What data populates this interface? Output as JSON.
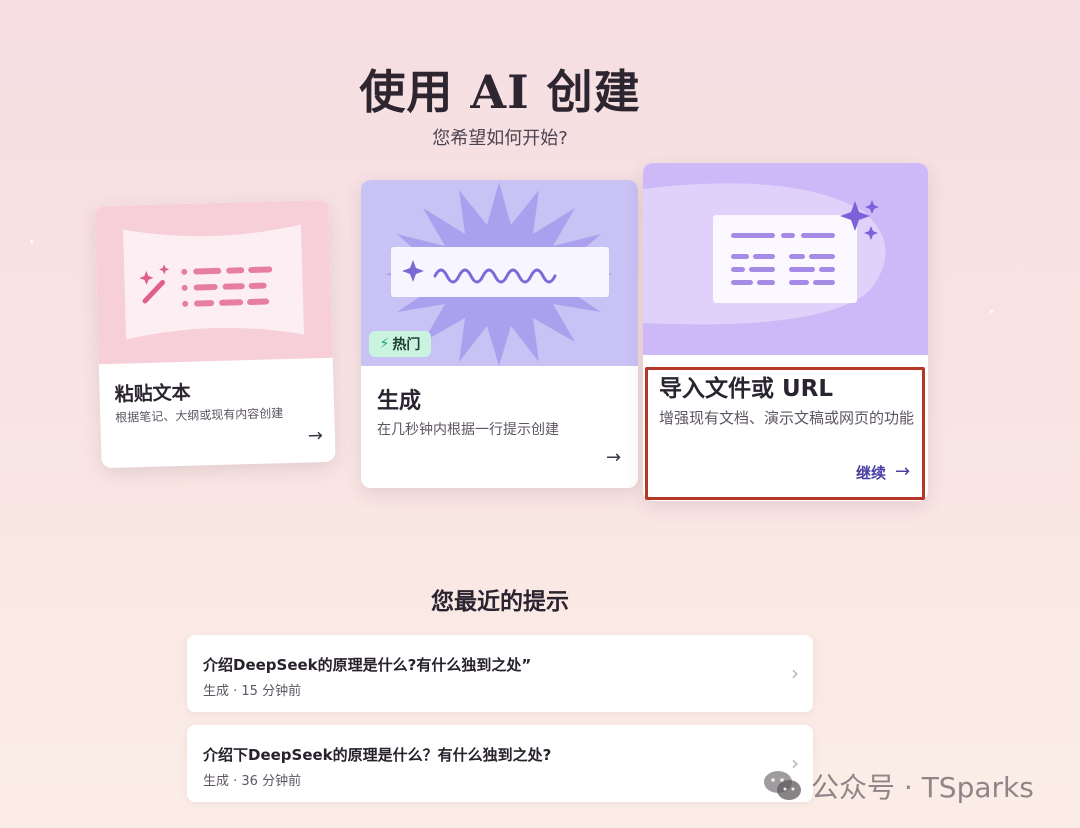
{
  "header": {
    "title": "使用 AI 创建",
    "subtitle": "您希望如何开始?"
  },
  "cards": {
    "paste": {
      "title": "粘贴文本",
      "description": "根据笔记、大纲或现有内容创建",
      "action_icon": "arrow-right-icon"
    },
    "generate": {
      "badge": "热门",
      "title": "生成",
      "description": "在几秒钟内根据一行提示创建",
      "action_icon": "arrow-right-icon"
    },
    "import": {
      "title": "导入文件或 URL",
      "description": "增强现有文档、演示文稿或网页的功能",
      "continue_label": "继续",
      "highlighted": true,
      "highlight_color": "#b53728"
    }
  },
  "recent": {
    "title": "您最近的提示",
    "items": [
      {
        "prompt": "介绍DeepSeek的原理是什么?有什么独到之处”",
        "meta": "生成 · 15 分钟前"
      },
      {
        "prompt": "介绍下DeepSeek的原理是什么？有什么独到之处?",
        "meta": "生成 · 36 分钟前"
      }
    ]
  },
  "watermark": {
    "text": "公众号 · TSparks",
    "icon": "wechat-icon"
  },
  "colors": {
    "accent": "#4b3fa2",
    "badge_bg": "#c9f3df",
    "paste_art": "#f6cfd9",
    "generate_art": "#c9c2f4",
    "import_art": "#cdb9f7"
  }
}
